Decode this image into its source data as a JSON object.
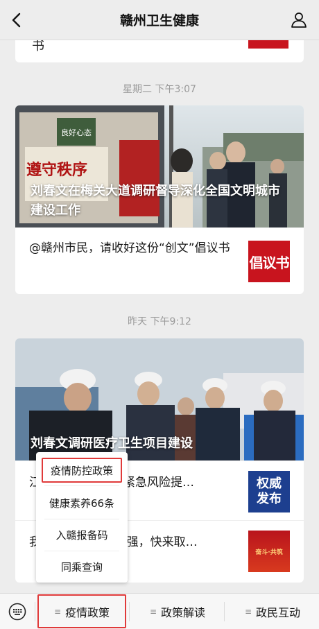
{
  "nav": {
    "title": "赣州卫生健康"
  },
  "top_card": {
    "stub_char": "书"
  },
  "timestamps": [
    "星期二 下午3:07",
    "昨天 下午9:12"
  ],
  "article1": {
    "hero_title": "刘春文在梅关大道调研督导深化全国文明城市建设工作",
    "hero_signs": [
      "良好心态",
      "遵守秩序"
    ],
    "items": [
      {
        "text": "@赣州市民，请收好这份“创文”倡议书",
        "thumb": "倡议书"
      }
    ]
  },
  "article2": {
    "hero_title": "刘春文调研医疗卫生项目建设",
    "items": [
      {
        "text": "江…　　肺炎疫情紧急风险提…",
        "thumb": [
          "权威",
          "发布"
        ]
      },
      {
        "text": "我…　　品进入20强，快来取…",
        "thumb": "奋斗·共筑"
      }
    ]
  },
  "popup_menu": {
    "items": [
      "疫情防控政策",
      "健康素养66条",
      "入赣报备码",
      "同乘查询"
    ]
  },
  "bottom_menu": {
    "tabs": [
      "疫情政策",
      "政策解读",
      "政民互动"
    ]
  },
  "colors": {
    "highlight": "#e03a3a",
    "thumb_red": "#c8141e",
    "thumb_blue": "#1d3f8f"
  }
}
